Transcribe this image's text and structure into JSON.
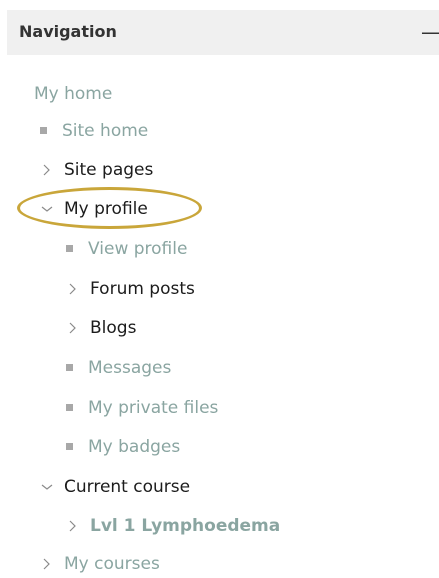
{
  "navigation": {
    "title": "Navigation",
    "collapse_symbol": "—",
    "items": [
      {
        "label": "My home",
        "type": "link",
        "icon": "none"
      },
      {
        "label": "Site home",
        "type": "link",
        "icon": "bullet-icon"
      },
      {
        "label": "Site pages",
        "type": "branch",
        "icon": "chevron-right-icon"
      },
      {
        "label": "My profile",
        "type": "branch",
        "icon": "chevron-down-icon",
        "expanded": true,
        "highlighted": true
      },
      {
        "label": "View profile",
        "type": "link",
        "icon": "bullet-icon"
      },
      {
        "label": "Forum posts",
        "type": "branch",
        "icon": "chevron-right-icon"
      },
      {
        "label": "Blogs",
        "type": "branch",
        "icon": "chevron-right-icon"
      },
      {
        "label": "Messages",
        "type": "link",
        "icon": "bullet-icon"
      },
      {
        "label": "My private files",
        "type": "link",
        "icon": "bullet-icon"
      },
      {
        "label": "My badges",
        "type": "link",
        "icon": "bullet-icon"
      },
      {
        "label": "Current course",
        "type": "branch",
        "icon": "chevron-down-icon",
        "expanded": true
      },
      {
        "label": "Lvl 1 Lymphoedema",
        "type": "branch",
        "icon": "chevron-right-icon",
        "bold": true
      },
      {
        "label": "My courses",
        "type": "branch",
        "icon": "chevron-right-icon"
      }
    ]
  },
  "colors": {
    "header_bg": "#f0f0f0",
    "link": "#8aa5a1",
    "text": "#1c1c1c",
    "highlight": "#c9a63a",
    "bullet": "#a8a8a8"
  }
}
